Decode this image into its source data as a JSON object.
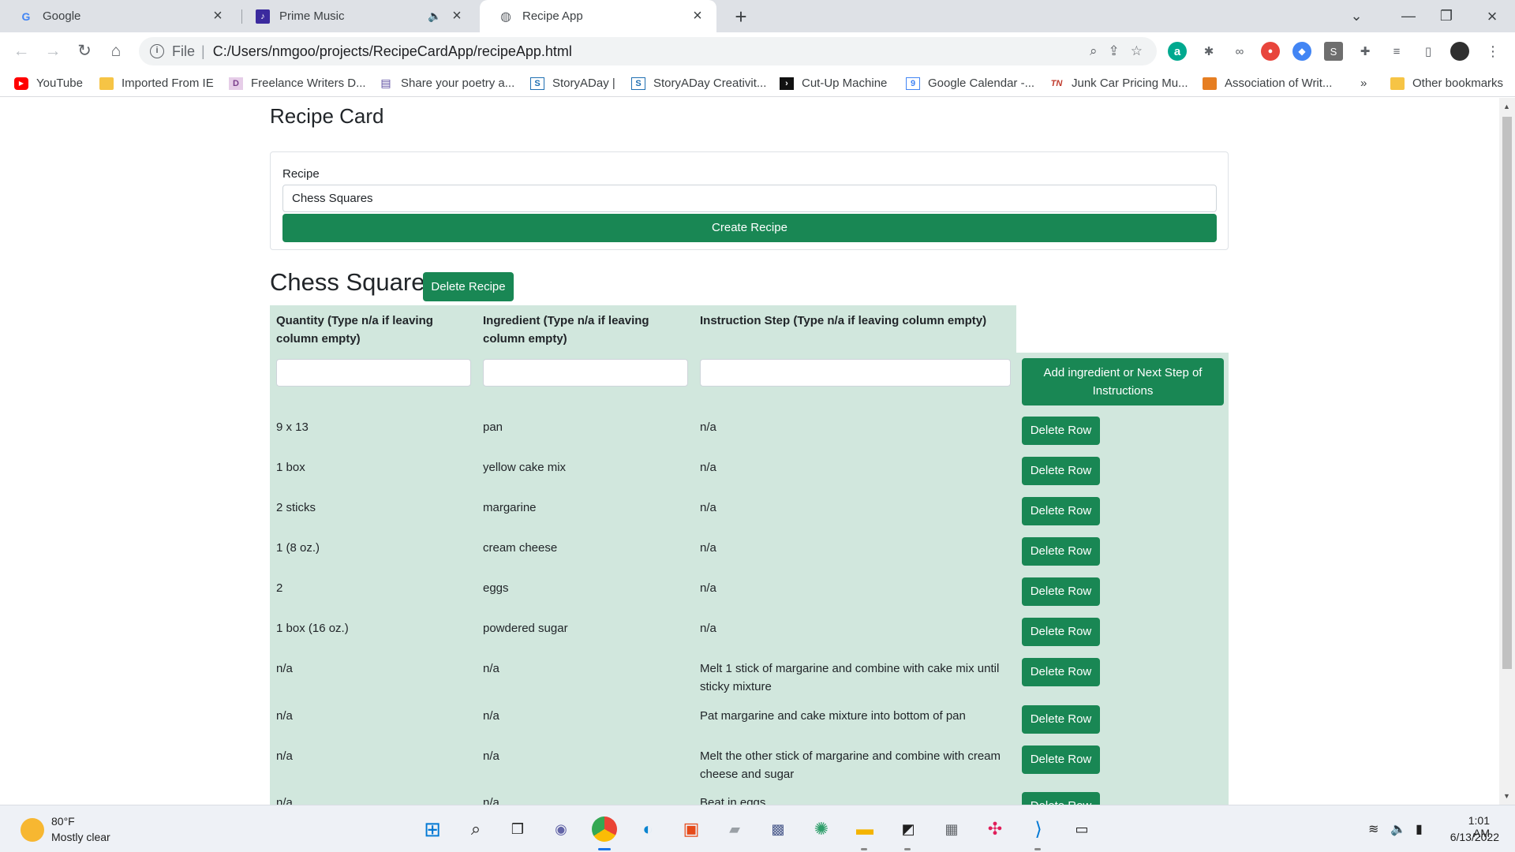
{
  "browser": {
    "tabs": [
      {
        "title": "Google",
        "icon": "G",
        "icon_color": "#4285f4"
      },
      {
        "title": "Prime Music",
        "icon": "♪",
        "icon_color": "#3b2a9e"
      },
      {
        "title": "Recipe App",
        "icon": "◍",
        "icon_color": "#5f6368"
      }
    ],
    "address": {
      "scheme": "File",
      "separator": "|",
      "url": "C:/Users/nmgoo/projects/RecipeCardApp/recipeApp.html"
    },
    "bookmarks": [
      "YouTube",
      "Imported From IE",
      "Freelance Writers D...",
      "Share your poetry a...",
      "StoryADay |",
      "StoryADay Creativit...",
      "Cut-Up Machine",
      "Google Calendar -...",
      "Junk Car Pricing Mu...",
      "Association of Writ...",
      "Other bookmarks"
    ],
    "bookmarks_overflow": "»",
    "extension_labels": {
      "s": "S",
      "a": "a"
    }
  },
  "page": {
    "title": "Recipe Card",
    "form": {
      "label": "Recipe",
      "value": "Chess Squares",
      "create_button": "Create Recipe"
    },
    "recipe": {
      "name": "Chess Squares",
      "delete_button": "Delete Recipe",
      "headers": [
        "Quantity (Type n/a if leaving column empty)",
        "Ingredient (Type n/a if leaving column empty)",
        "Instruction Step (Type n/a if leaving column empty)"
      ],
      "add_button": "Add ingredient or Next Step of Instructions",
      "delete_row_label": "Delete Row",
      "rows": [
        {
          "quantity": "9 x 13",
          "ingredient": "pan",
          "instruction": "n/a"
        },
        {
          "quantity": "1 box",
          "ingredient": "yellow cake mix",
          "instruction": "n/a"
        },
        {
          "quantity": "2 sticks",
          "ingredient": "margarine",
          "instruction": "n/a"
        },
        {
          "quantity": "1 (8 oz.)",
          "ingredient": "cream cheese",
          "instruction": "n/a"
        },
        {
          "quantity": "2",
          "ingredient": "eggs",
          "instruction": "n/a"
        },
        {
          "quantity": "1 box (16 oz.)",
          "ingredient": "powdered sugar",
          "instruction": "n/a"
        },
        {
          "quantity": "n/a",
          "ingredient": "n/a",
          "instruction": "Melt 1 stick of margarine and combine with cake mix until sticky mixture"
        },
        {
          "quantity": "n/a",
          "ingredient": "n/a",
          "instruction": "Pat margarine and cake mixture into bottom of pan"
        },
        {
          "quantity": "n/a",
          "ingredient": "n/a",
          "instruction": "Melt the other stick of margarine and combine with cream cheese and sugar"
        },
        {
          "quantity": "n/a",
          "ingredient": "n/a",
          "instruction": "Beat in eggs"
        }
      ]
    }
  },
  "taskbar": {
    "weather": {
      "temp": "80°F",
      "desc": "Mostly clear"
    },
    "clock": {
      "time": "1:01 AM",
      "date": "6/13/2022"
    }
  },
  "colors": {
    "accent": "#198754",
    "table_bg": "#d1e7dd"
  }
}
